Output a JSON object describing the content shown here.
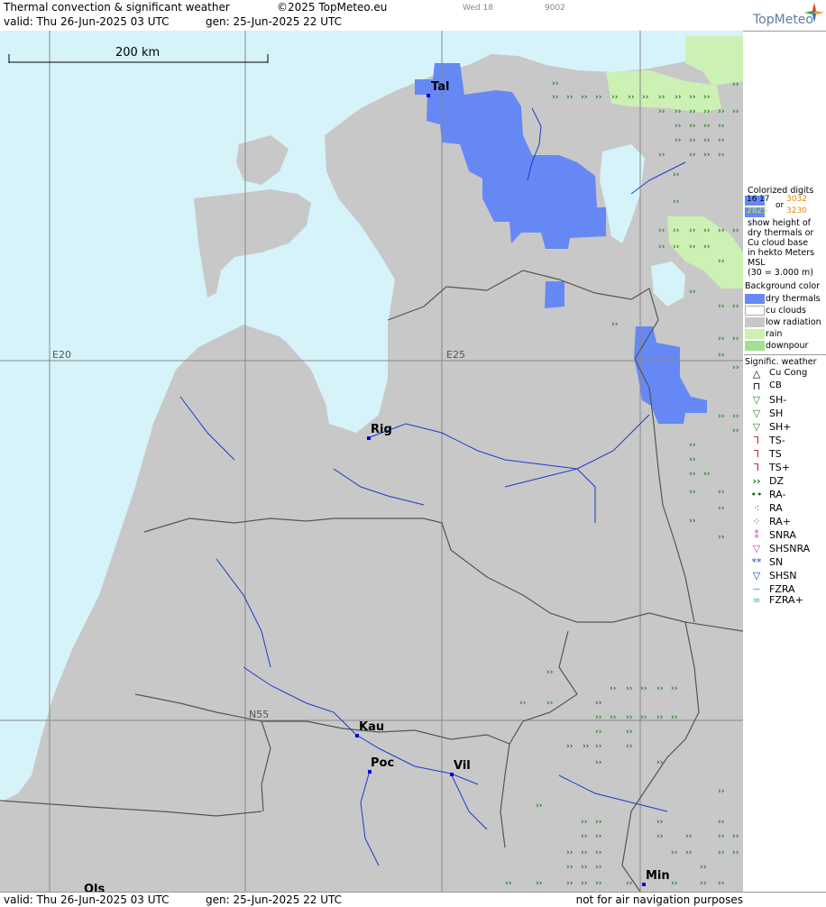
{
  "header": {
    "title": "Thermal convection & significant weather",
    "copyright": "©2025 TopMeteo.eu",
    "small1": "Wed 18",
    "small2": "9002",
    "valid": "valid:  Thu   26-Jun-2025  03 UTC",
    "gen": "gen: 25-Jun-2025 22 UTC",
    "logo": "TopMeteo"
  },
  "footer": {
    "valid": "valid:  Thu   26-Jun-2025  03 UTC",
    "gen": "gen: 25-Jun-2025 22 UTC",
    "note": "not for air navigation purposes"
  },
  "map": {
    "scale_label": "200 km",
    "lon_labels": [
      "E20",
      "E25"
    ],
    "lat_labels": [
      "N55"
    ],
    "cities": [
      "Tal",
      "Rig",
      "Kau",
      "Poc",
      "Vil",
      "Min",
      "Ols"
    ]
  },
  "legend": {
    "colorized_title": "Colorized digits",
    "digits": [
      "16",
      "17",
      "3032",
      "or",
      "2825",
      "3230"
    ],
    "desc": [
      "show height of",
      "dry thermals or",
      "Cu cloud base",
      "in hekto Meters",
      "MSL",
      "(30 = 3.000 m)"
    ],
    "bg_title": "Background color",
    "bg_items": [
      {
        "label": "dry thermals",
        "color": "#6688f5"
      },
      {
        "label": "cu clouds",
        "color": "#ffffff"
      },
      {
        "label": "low radiation",
        "color": "#c8c8c8"
      },
      {
        "label": "rain",
        "color": "#cdf0b4"
      },
      {
        "label": "downpour",
        "color": "#a0e090"
      }
    ],
    "sig_title": "Signific. weather",
    "sig_items": [
      "Cu Cong",
      "CB",
      "SH-",
      "SH",
      "SH+",
      "TS-",
      "TS",
      "TS+",
      "DZ",
      "RA-",
      "RA",
      "RA+",
      "SNRA",
      "SHSNRA",
      "SN",
      "SHSN",
      "FZRA",
      "FZRA+"
    ]
  },
  "colors": {
    "sea": "#d6f3fa",
    "land": "#c8c8c8",
    "thermals": "#6688f5",
    "rain": "#cdf0b4",
    "river": "#1a3ad0",
    "border": "#555555",
    "grid": "#888888",
    "drizzle": "#1e7e1e"
  }
}
